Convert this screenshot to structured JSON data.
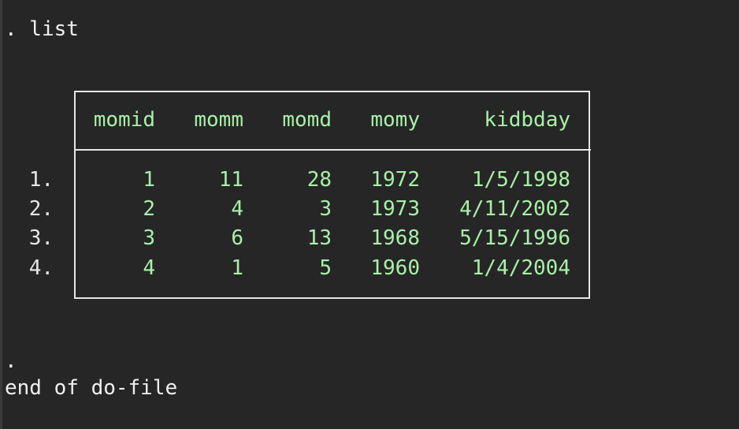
{
  "command": ". list",
  "prompt_end": ".",
  "footer": "end of do-file",
  "table": {
    "headers": [
      "momid",
      "momm",
      "momd",
      "momy",
      "kidbday"
    ],
    "rows": [
      {
        "num": "1.",
        "cells": [
          "1",
          "11",
          "28",
          "1972",
          "1/5/1998"
        ]
      },
      {
        "num": "2.",
        "cells": [
          "2",
          "4",
          "3",
          "1973",
          "4/11/2002"
        ]
      },
      {
        "num": "3.",
        "cells": [
          "3",
          "6",
          "13",
          "1968",
          "5/15/1996"
        ]
      },
      {
        "num": "4.",
        "cells": [
          "4",
          "1",
          "5",
          "1960",
          "1/4/2004"
        ]
      }
    ]
  },
  "colors": {
    "background": "#262626",
    "text": "#f0f0f0",
    "result": "#a8f0a8"
  }
}
